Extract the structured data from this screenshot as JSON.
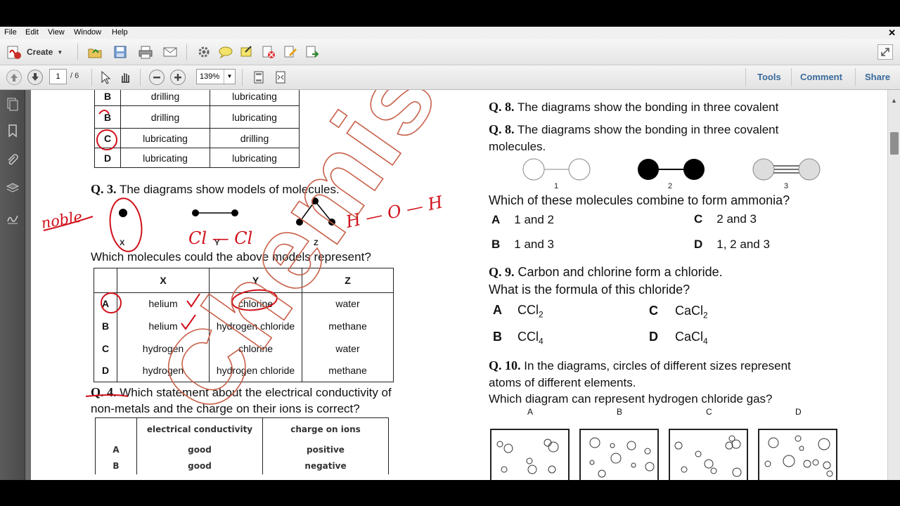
{
  "menu": [
    "File",
    "Edit",
    "View",
    "Window",
    "Help"
  ],
  "toolbar": {
    "create_label": "Create",
    "page_current": "1",
    "page_total": "/ 6",
    "zoom": "139%",
    "tools_label": "Tools",
    "comment_label": "Comment",
    "share_label": "Share"
  },
  "doc": {
    "q2_table": {
      "rows": [
        [
          "B",
          "drilling",
          "lubricating"
        ],
        [
          "B",
          "drilling",
          "lubricating"
        ],
        [
          "C",
          "lubricating",
          "drilling"
        ],
        [
          "D",
          "lubricating",
          "lubricating"
        ]
      ]
    },
    "q3": {
      "number": "Q. 3.",
      "text": "The diagrams show models of molecules.",
      "labels": [
        "X",
        "Y",
        "Z"
      ],
      "question": "Which molecules could the above models represent?",
      "headers": [
        "",
        "X",
        "Y",
        "Z"
      ],
      "rows": [
        [
          "A",
          "helium",
          "chlorine",
          "water"
        ],
        [
          "B",
          "helium",
          "hydrogen chloride",
          "methane"
        ],
        [
          "C",
          "hydrogen",
          "chlorine",
          "water"
        ],
        [
          "D",
          "hydrogen",
          "hydrogen chloride",
          "methane"
        ]
      ]
    },
    "q4": {
      "number": "Q. 4.",
      "text1": "Which statement about the electrical conductivity of",
      "text2": "non-metals and the charge on their ions is correct?",
      "headers": [
        "",
        "electrical conductivity",
        "charge on ions"
      ],
      "rows": [
        [
          "A",
          "good",
          "positive"
        ],
        [
          "B",
          "good",
          "negative"
        ]
      ]
    },
    "q8_partial": {
      "number": "Q. 8.",
      "text": "The diagrams show the bonding in three covalent"
    },
    "q8": {
      "number": "Q. 8.",
      "text1": "The diagrams show the bonding in three covalent",
      "text2": "molecules.",
      "diagram_labels": [
        "1",
        "2",
        "3"
      ],
      "question": "Which of these molecules combine to form ammonia?",
      "options": [
        {
          "letter": "A",
          "text": "1 and 2"
        },
        {
          "letter": "B",
          "text": "1 and 3"
        },
        {
          "letter": "C",
          "text": "2 and 3"
        },
        {
          "letter": "D",
          "text": "1, 2 and 3"
        }
      ]
    },
    "q9": {
      "number": "Q. 9.",
      "text1": "Carbon and chlorine form a chloride.",
      "text2": "What is the formula of this chloride?",
      "options": [
        {
          "letter": "A",
          "text": "CCl",
          "sub": "2"
        },
        {
          "letter": "B",
          "text": "CCl",
          "sub": "4"
        },
        {
          "letter": "C",
          "text": "CaCl",
          "sub": "2"
        },
        {
          "letter": "D",
          "text": "CaCl",
          "sub": "4"
        }
      ]
    },
    "q10": {
      "number": "Q. 10.",
      "text1": "In the diagrams, circles of different sizes represent",
      "text2": "atoms of different elements.",
      "question": "Which diagram can represent hydrogen chloride gas?",
      "box_labels": [
        "A",
        "B",
        "C",
        "D"
      ]
    },
    "annotations": {
      "noble": "noble",
      "cl_cl": "Cl — Cl",
      "h_o_h": "H — O — H"
    },
    "watermark_text": "Chemistry BILAL"
  },
  "colors": {
    "annotation": "#d0101a",
    "watermark": "#c8604a",
    "link": "#3a6a9a"
  }
}
